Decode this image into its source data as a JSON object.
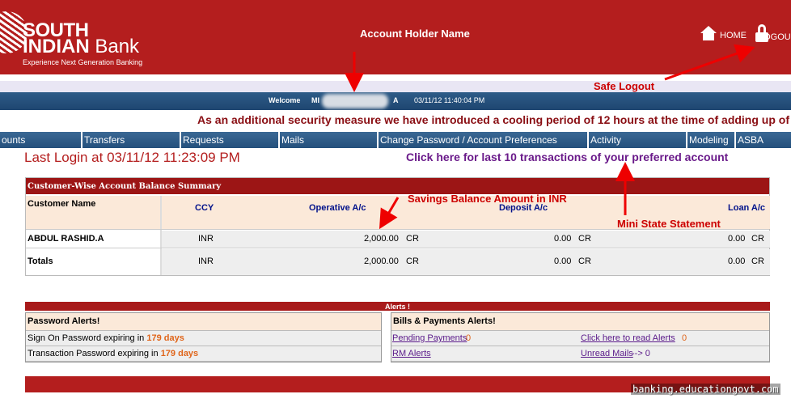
{
  "header": {
    "logo_line1": "SOUTH",
    "logo_line2_bold": "INDIAN",
    "logo_line2_rest": " Bank",
    "logo_tagline": "Experience Next Generation Banking",
    "home_label": "HOME",
    "logout_label": "LOGOUT"
  },
  "welcome": {
    "prefix": "Welcome",
    "name_start": "MI",
    "name_end": "A",
    "datetime": "03/11/12 11:40:04 PM"
  },
  "marquee_text": "As an additional security measure we have introduced a cooling period of 12 hours at the time of adding up of a new",
  "nav": {
    "items": [
      "ounts",
      "Transfers",
      "Requests",
      "Mails",
      "Change Password / Account Preferences",
      "Activity",
      "Modeling",
      "ASBA"
    ]
  },
  "last_login": "Last Login at 03/11/12 11:23:09 PM",
  "mini_statement_link": "Click here for last 10 transactions of your preferred account",
  "summary": {
    "title": "Customer-Wise Account Balance Summary",
    "headers": {
      "customer": "Customer Name",
      "ccy": "CCY",
      "operative": "Operative A/c",
      "deposit": "Deposit A/c",
      "loan": "Loan A/c"
    },
    "rows": [
      {
        "name": "ABDUL RASHID.A",
        "ccy": "INR",
        "operative": "2,000.00",
        "op_dc": "CR",
        "deposit": "0.00",
        "dep_dc": "CR",
        "loan": "0.00",
        "loan_dc": "CR"
      },
      {
        "name": "Totals",
        "ccy": "INR",
        "operative": "2,000.00",
        "op_dc": "CR",
        "deposit": "0.00",
        "dep_dc": "CR",
        "loan": "0.00",
        "loan_dc": "CR"
      }
    ]
  },
  "alerts": {
    "title": "Alerts !",
    "password": {
      "title": "Password Alerts!",
      "signon_text": "Sign On Password expiring in",
      "signon_days": "179 days",
      "txn_text": "Transaction Password expiring in",
      "txn_days": "179 days"
    },
    "bills": {
      "title": "Bills & Payments Alerts!",
      "pending_label": "Pending Payments",
      "pending_count": "0",
      "read_alerts_label": "Click here to read Alerts",
      "read_alerts_count": "0",
      "rm_alerts_label": "RM Alerts",
      "unread_mails_label": "Unread Mails",
      "unread_mails_suffix": "--> 0"
    }
  },
  "annotations": {
    "account_holder": "Account Holder Name",
    "safe_logout": "Safe Logout",
    "savings_balance": "Savings Balance Amount in INR",
    "mini_statement": "Mini State Statement"
  },
  "watermark": "banking.educationgovt.com",
  "colors": {
    "brand_red": "#b41e1e",
    "nav_blue": "#2e5c88",
    "header_navy": "#00118a",
    "annotation_red": "#cc0000",
    "alert_orange": "#e0651a"
  }
}
